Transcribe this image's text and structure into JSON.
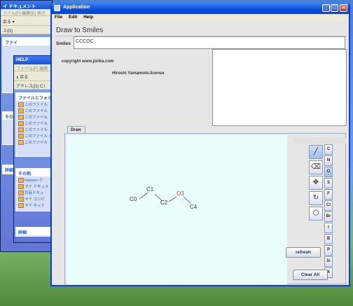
{
  "bg1": {
    "title": "イ ドキュメント",
    "menu": "ァイル(F)  編集(E)  表示",
    "tools": "戻る ▾",
    "addr": "ス(D)",
    "panel_title": "ファイ",
    "items": [
      "",
      "",
      "",
      "",
      "",
      ""
    ],
    "other_title": "その他",
    "details_title": "詳細"
  },
  "bg2": {
    "title": "HELP",
    "menu": "ファイル(F)  編集",
    "tools": "戻る",
    "addr": "アドレス(D)",
    "addr_value": "C:\\",
    "panel_title": "ファイルとフォルダ",
    "items": [
      "このファイル",
      "このファイル",
      "このファイル",
      "このファイル",
      "このファイル",
      "このファイル する",
      "このファイル"
    ],
    "other_title": "その他",
    "other_items": [
      "Hansen-ク",
      "マイ ドキュメ",
      "共有ドキュ",
      "マイ コンピ",
      "マイ ネット"
    ],
    "details_title": "詳細"
  },
  "app": {
    "title": "Application",
    "menu": [
      "File",
      "Edit",
      "Help"
    ],
    "heading": "Draw to Smiles",
    "smiles_label": "Smiles",
    "smiles_value": "CCCOC",
    "copyright": "copyright www.pirika.com",
    "license": "Hiroshi Yamamoto.license",
    "tab_draw": "Draw",
    "tools": [
      {
        "icon": "bond-line-icon",
        "glyph": "╱"
      },
      {
        "icon": "eraser-icon",
        "glyph": "⌫"
      },
      {
        "icon": "move-icon",
        "glyph": "✥"
      },
      {
        "icon": "rotate-icon",
        "glyph": "↻"
      },
      {
        "icon": "benzene-ring-icon",
        "glyph": "⬡"
      }
    ],
    "elements": [
      "C",
      "N",
      "O",
      "S",
      "F",
      "Cl",
      "Br",
      "I",
      "B",
      "P",
      "Si",
      "X"
    ],
    "selected_element": "O",
    "refresh_label": "refresh",
    "clearall_label": "Clear All",
    "molecule": {
      "atoms": [
        {
          "label": "C0",
          "element": "C"
        },
        {
          "label": "C1",
          "element": "C"
        },
        {
          "label": "C2",
          "element": "C"
        },
        {
          "label": "O3",
          "element": "O"
        },
        {
          "label": "C4",
          "element": "C"
        }
      ],
      "bond_color": "#444444",
      "oxygen_color": "#e0302c"
    }
  }
}
